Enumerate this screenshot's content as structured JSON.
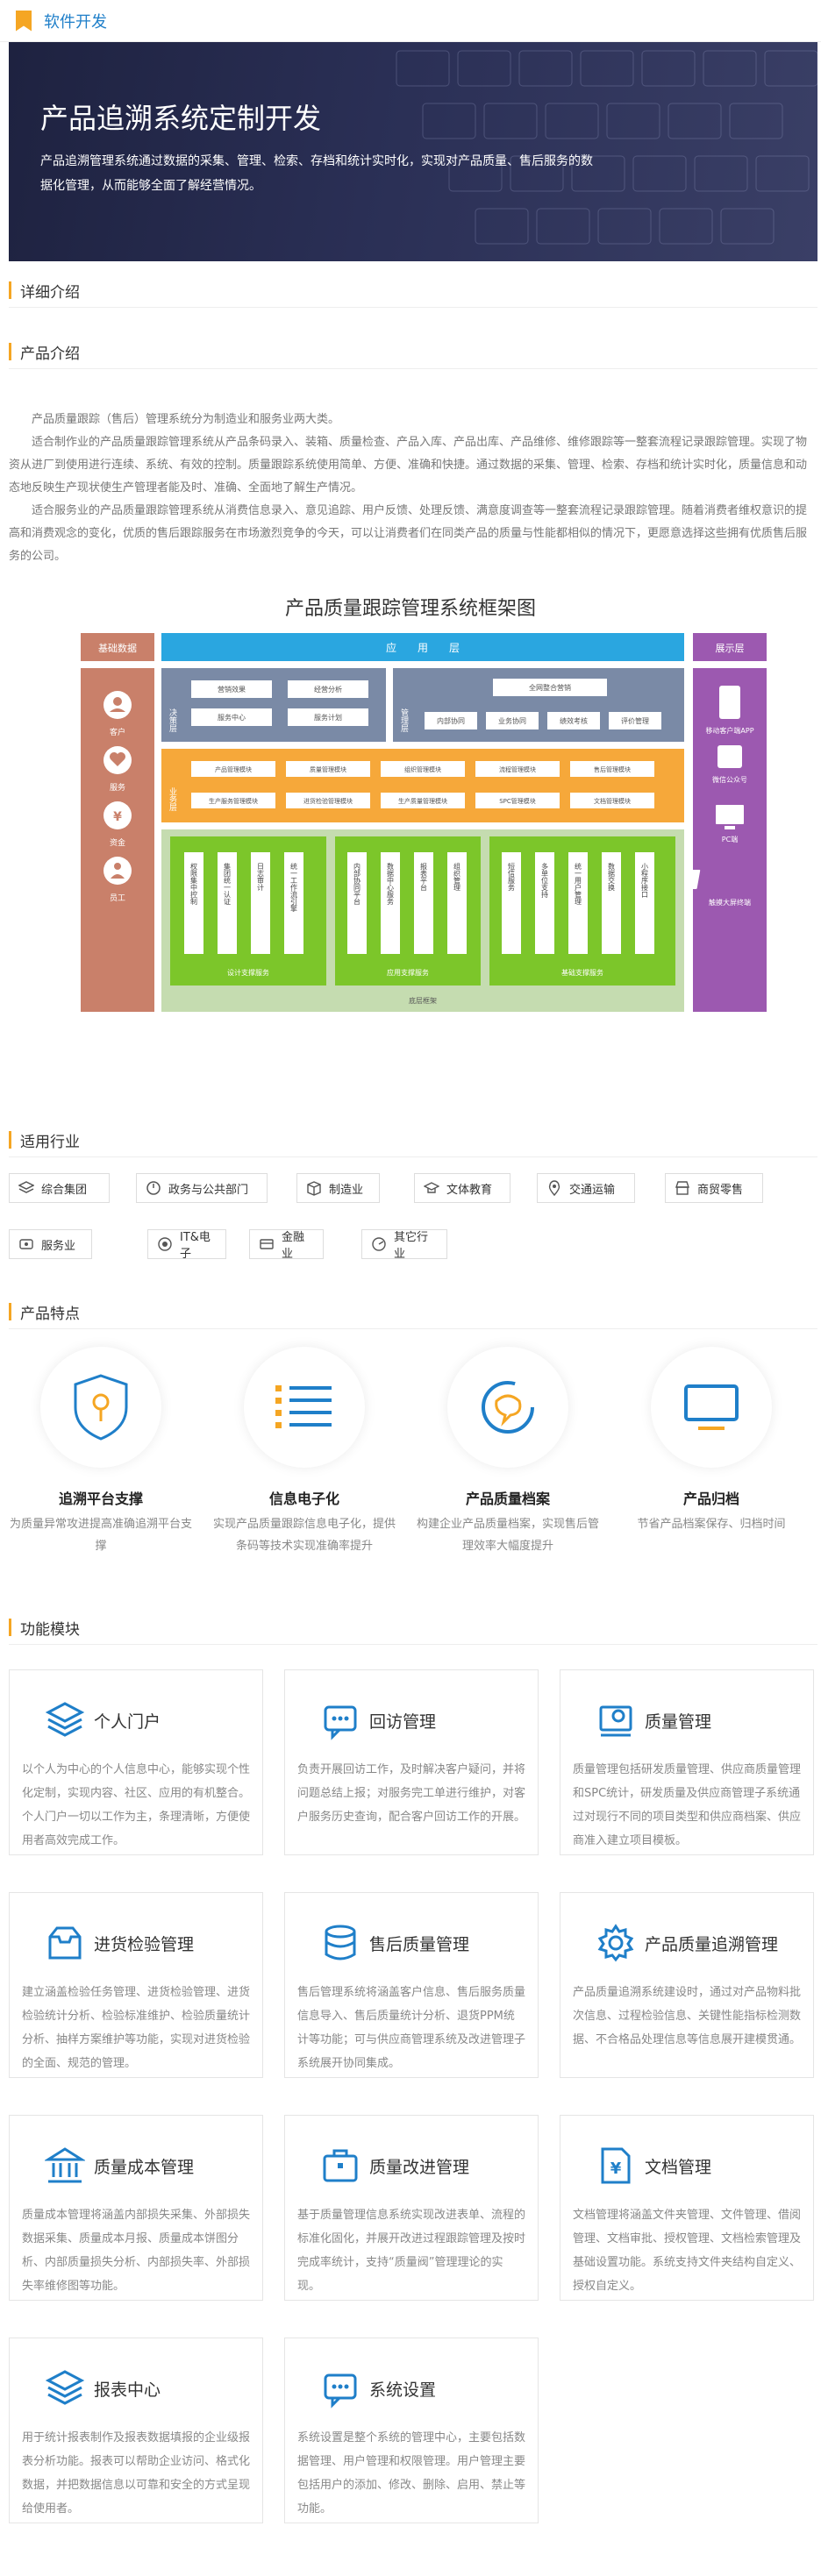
{
  "topbar": {
    "title": "软件开发"
  },
  "hero": {
    "title": "产品追溯系统定制开发",
    "desc": "产品追溯管理系统通过数据的采集、管理、检索、存档和统计实时化，实现对产品质量、售后服务的数据化管理，从而能够全面了解经营情况。"
  },
  "sections": {
    "detail": "详细介绍",
    "product_intro": "产品介绍",
    "industry": "适用行业",
    "features": "产品特点",
    "modules": "功能模块"
  },
  "intro": [
    "产品质量跟踪（售后）管理系统分为制造业和服务业两大类。",
    "适合制作业的产品质量跟踪管理系统从产品条码录入、装箱、质量检查、产品入库、产品出库、产品维修、维修跟踪等一整套流程记录跟踪管理。实现了物资从进厂到使用进行连续、系统、有效的控制。质量跟踪系统使用简单、方便、准确和快捷。通过数据的采集、管理、检索、存档和统计实时化，质量信息和动态地反映生产现状使生产管理者能及时、准确、全面地了解生产情况。",
    "适合服务业的产品质量跟踪管理系统从消费信息录入、意见追踪、用户反馈、处理反馈、满意度调查等一整套流程记录跟踪管理。随着消费者维权意识的提高和消费观念的变化，优质的售后跟踪服务在市场激烈竞争的今天，可以让消费者们在同类产品的质量与性能都相似的情况下，更愿意选择这些拥有优质售后服务的公司。"
  ],
  "framework": {
    "title": "产品质量跟踪管理系统框架图",
    "left_header": "基础数据",
    "left_items": [
      "客户",
      "服务",
      "资金",
      "员工"
    ],
    "app_layer": "应　　用　　层",
    "right_header": "展示层",
    "right_items": [
      "移动客户端APP",
      "微信公众号",
      "PC端",
      "触摸大屏终端"
    ],
    "decision_label": "决策层",
    "decision_items": [
      "营销效果",
      "经营分析",
      "服务中心",
      "服务计划"
    ],
    "mgmt_label": "管理层",
    "mgmt_items": [
      "全网整合营销",
      "内部协同",
      "业务协同",
      "绩效考核",
      "评价管理"
    ],
    "biz_label": "业务层",
    "biz_items": [
      "产品管理模块",
      "质量管理模块",
      "组织管理模块",
      "流程管理模块",
      "售后管理模块",
      "生产服务管理模块",
      "进货检验管理模块",
      "生产质量管理模块",
      "SPC管理模块",
      "文档管理模块"
    ],
    "groups": [
      {
        "title": "设计支撑服务",
        "items": [
          "权限集中控制",
          "集团统一认证",
          "日志审计",
          "统一工作流引擎"
        ]
      },
      {
        "title": "应用支撑服务",
        "items": [
          "内部协同平台",
          "数据中心服务",
          "报表平台",
          "组织管理"
        ]
      },
      {
        "title": "基础支撑服务",
        "items": [
          "短信服务",
          "多单位支持",
          "统一用户管理",
          "数据交换",
          "小程序接口"
        ]
      }
    ],
    "bottom": "底层框架"
  },
  "industries": [
    {
      "label": "综合集团",
      "icon": "layers-icon"
    },
    {
      "label": "政务与公共部门",
      "icon": "government-icon"
    },
    {
      "label": "制造业",
      "icon": "box-icon"
    },
    {
      "label": "文体教育",
      "icon": "graduation-icon"
    },
    {
      "label": "交通运输",
      "icon": "location-icon"
    },
    {
      "label": "商贸零售",
      "icon": "store-icon"
    },
    {
      "label": "服务业",
      "icon": "service-icon"
    },
    {
      "label": "IT&电子",
      "icon": "tech-icon"
    },
    {
      "label": "金融业",
      "icon": "card-icon"
    },
    {
      "label": "其它行业",
      "icon": "other-icon"
    }
  ],
  "features": [
    {
      "title": "追溯平台支撑",
      "desc": "为质量异常攻进提高准确追溯平台支撑",
      "icon": "shield-icon"
    },
    {
      "title": "信息电子化",
      "desc": "实现产品质量跟踪信息电子化，提供条码等技术实现准确率提升",
      "icon": "list-icon"
    },
    {
      "title": "产品质量档案",
      "desc": "构建企业产品质量档案，实现售后管理效率大幅度提升",
      "icon": "chat-icon"
    },
    {
      "title": "产品归档",
      "desc": "节省产品档案保存、归档时间",
      "icon": "monitor-icon"
    }
  ],
  "modules": [
    {
      "title": "个人门户",
      "desc": "以个人为中心的个人信息中心，能够实现个性化定制，实现内容、社区、应用的有机整合。个人门户一切以工作为主，条理清晰，方便使用者高效完成工作。",
      "icon": "layers-icon"
    },
    {
      "title": "回访管理",
      "desc": "负责开展回访工作，及时解决客户疑问，并将问题总结上报；对服务完工单进行维护，对客户服务历史查询，配合客户回访工作的开展。",
      "icon": "chat-icon"
    },
    {
      "title": "质量管理",
      "desc": "质量管理包括研发质量管理、供应商质量管理和SPC统计，研发质量及供应商管理子系统通过对现行不同的项目类型和供应商档案、供应商准入建立项目模板。",
      "icon": "quality-icon"
    },
    {
      "title": "进货检验管理",
      "desc": "建立涵盖检验任务管理、进货检验管理、进货检验统计分析、检验标准维护、检验质量统计分析、抽样方案维护等功能，实现对进货检验的全面、规范的管理。",
      "icon": "inbox-icon"
    },
    {
      "title": "售后质量管理",
      "desc": "售后管理系统将涵盖客户信息、售后服务质量信息导入、售后质量统计分析、退货PPM统计等功能；可与供应商管理系统及改进管理子系统展开协同集成。",
      "icon": "database-icon"
    },
    {
      "title": "产品质量追溯管理",
      "desc": "产品质量追溯系统建设时，通过对产品物料批次信息、过程检验信息、关键性能指标检测数据、不合格品处理信息等信息展开建模贯通。",
      "icon": "gear-icon"
    },
    {
      "title": "质量成本管理",
      "desc": "质量成本管理将涵盖内部损失采集、外部损失数据采集、质量成本月报、质量成本饼图分析、内部质量损失分析、内部损失率、外部损失率维修图等功能。",
      "icon": "bank-icon"
    },
    {
      "title": "质量改进管理",
      "desc": "基于质量管理信息系统实现改进表单、流程的标准化固化，并展开改进过程跟踪管理及按时完成率统计，支持“质量阀”管理理论的实现。",
      "icon": "briefcase-icon"
    },
    {
      "title": "文档管理",
      "desc": "文档管理将涵盖文件夹管理、文件管理、借阅管理、文档审批、授权管理、文档检索管理及基础设置功能。系统支持文件夹结构自定义、授权自定义。",
      "icon": "yen-doc-icon"
    },
    {
      "title": "报表中心",
      "desc": "用于统计报表制作及报表数据填报的企业级报表分析功能。报表可以帮助企业访问、格式化数据，并把数据信息以可靠和安全的方式呈现给使用者。",
      "icon": "layers-icon"
    },
    {
      "title": "系统设置",
      "desc": "系统设置是整个系统的管理中心，主要包括数据管理、用户管理和权限管理。用户管理主要包括用户的添加、修改、删除、启用、禁止等功能。",
      "icon": "chat-icon"
    }
  ],
  "colors": {
    "accent": "#f5a623",
    "blue": "#1f7fc9",
    "hero_bg": "#232846"
  }
}
